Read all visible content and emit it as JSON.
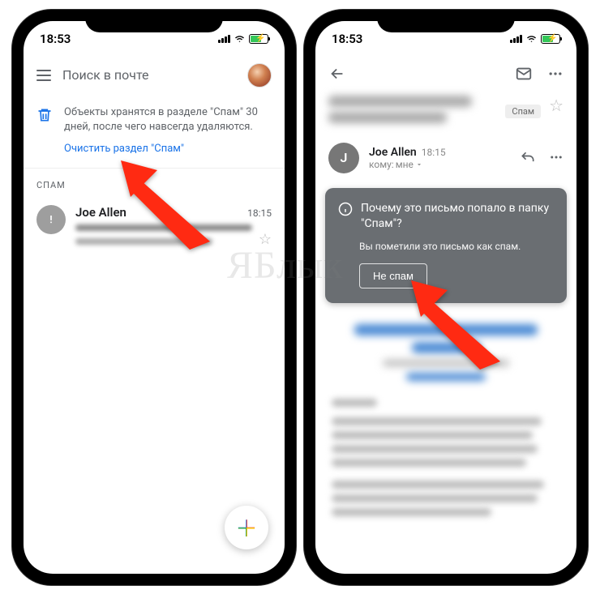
{
  "status": {
    "time": "18:53"
  },
  "left": {
    "search_placeholder": "Поиск в почте",
    "notice_text": "Объекты хранятся в разделе \"Спам\" 30 дней, после чего навсегда удаляются.",
    "clear_link": "Очистить раздел \"Спам\"",
    "section": "СПАМ",
    "mail": {
      "sender": "Joe Allen",
      "time": "18:15"
    }
  },
  "right": {
    "chip": "Спам",
    "sender": {
      "name": "Joe Allen",
      "initial": "J",
      "time": "18:15"
    },
    "to_prefix": "кому:",
    "to_value": "мне",
    "spam_card": {
      "title": "Почему это письмо попало в папку \"Спам\"?",
      "sub": "Вы пометили это письмо как спам.",
      "button": "Не спам"
    }
  },
  "watermark": "ЯБлык",
  "colors": {
    "link": "#1a73e8",
    "card": "#6a6e72",
    "arrow": "#ff2a12"
  }
}
